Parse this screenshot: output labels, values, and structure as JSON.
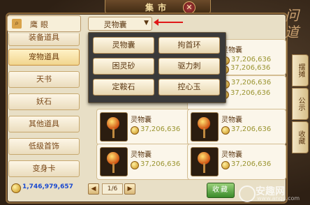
{
  "header": {
    "title": "集市"
  },
  "sidebar": {
    "search_label": "鹰眼",
    "categories": [
      {
        "label": "装备道具"
      },
      {
        "label": "宠物道具",
        "active": true
      },
      {
        "label": "天书"
      },
      {
        "label": "妖石"
      },
      {
        "label": "其他道具"
      },
      {
        "label": "低级首饰"
      },
      {
        "label": "变身卡"
      }
    ],
    "coins": "1,746,979,657"
  },
  "filter": {
    "selected": "灵物囊",
    "arrow": "▼"
  },
  "dropdown": {
    "options": [
      "灵物囊",
      "拘首环",
      "困灵砂",
      "驱力刺",
      "定鞍石",
      "控心玉"
    ]
  },
  "items": [
    {
      "name": "灵物囊",
      "price": "37,206,636"
    },
    {
      "name": "灵物囊",
      "price": "37,206,636"
    },
    {
      "name": "灵物囊",
      "price": "37,206,636"
    },
    {
      "name": "灵物囊",
      "price": "37,206,636"
    },
    {
      "name": "灵物囊",
      "price": "37,206,636"
    },
    {
      "name": "灵物囊",
      "price": "37,206,636"
    },
    {
      "name": "灵物囊",
      "price": "37,206,636"
    },
    {
      "name": "灵物囊",
      "price": "37,206,636"
    }
  ],
  "pager": {
    "text": "1/6",
    "prev": "◀",
    "next": "▶"
  },
  "sell_button": "收藏",
  "side_tabs": [
    "摆摊",
    "公示",
    "收藏"
  ],
  "watermark": {
    "name": "安趣网",
    "url": "www.anqu.com"
  }
}
